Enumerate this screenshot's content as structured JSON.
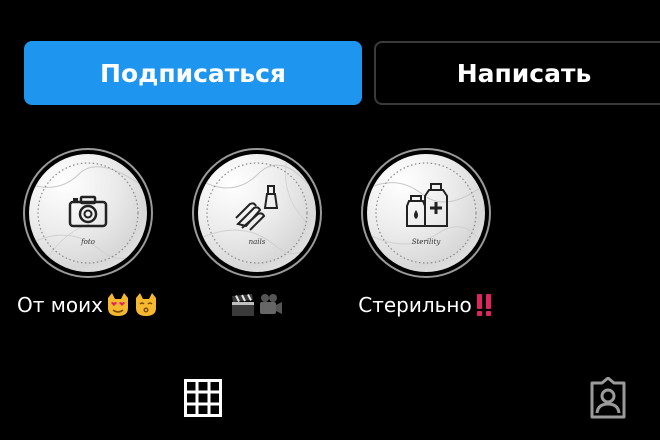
{
  "actions": {
    "follow_label": "Подписаться",
    "message_label": "Написать"
  },
  "highlights": [
    {
      "label": "От моих",
      "cover_caption": "foto",
      "cover_icon": "camera-icon",
      "label_emojis": [
        "heart-eyes-cat-emoji",
        "kissing-cat-emoji"
      ]
    },
    {
      "label": "",
      "cover_caption": "nails",
      "cover_icon": "nail-polish-hand-icon",
      "label_emojis": [
        "clapperboard-emoji",
        "movie-camera-emoji"
      ]
    },
    {
      "label": "Стерильно",
      "cover_caption": "Sterility",
      "cover_icon": "medicine-bottles-icon",
      "label_emojis": [
        "double-exclamation-emoji"
      ]
    }
  ],
  "tabs": [
    {
      "name": "grid",
      "icon": "grid-icon"
    },
    {
      "name": "tagged",
      "icon": "tagged-person-icon"
    }
  ],
  "colors": {
    "background": "#000000",
    "follow_button": "#1e96f0",
    "message_border": "#3a3a3a",
    "ring": "#9a9a9a"
  }
}
